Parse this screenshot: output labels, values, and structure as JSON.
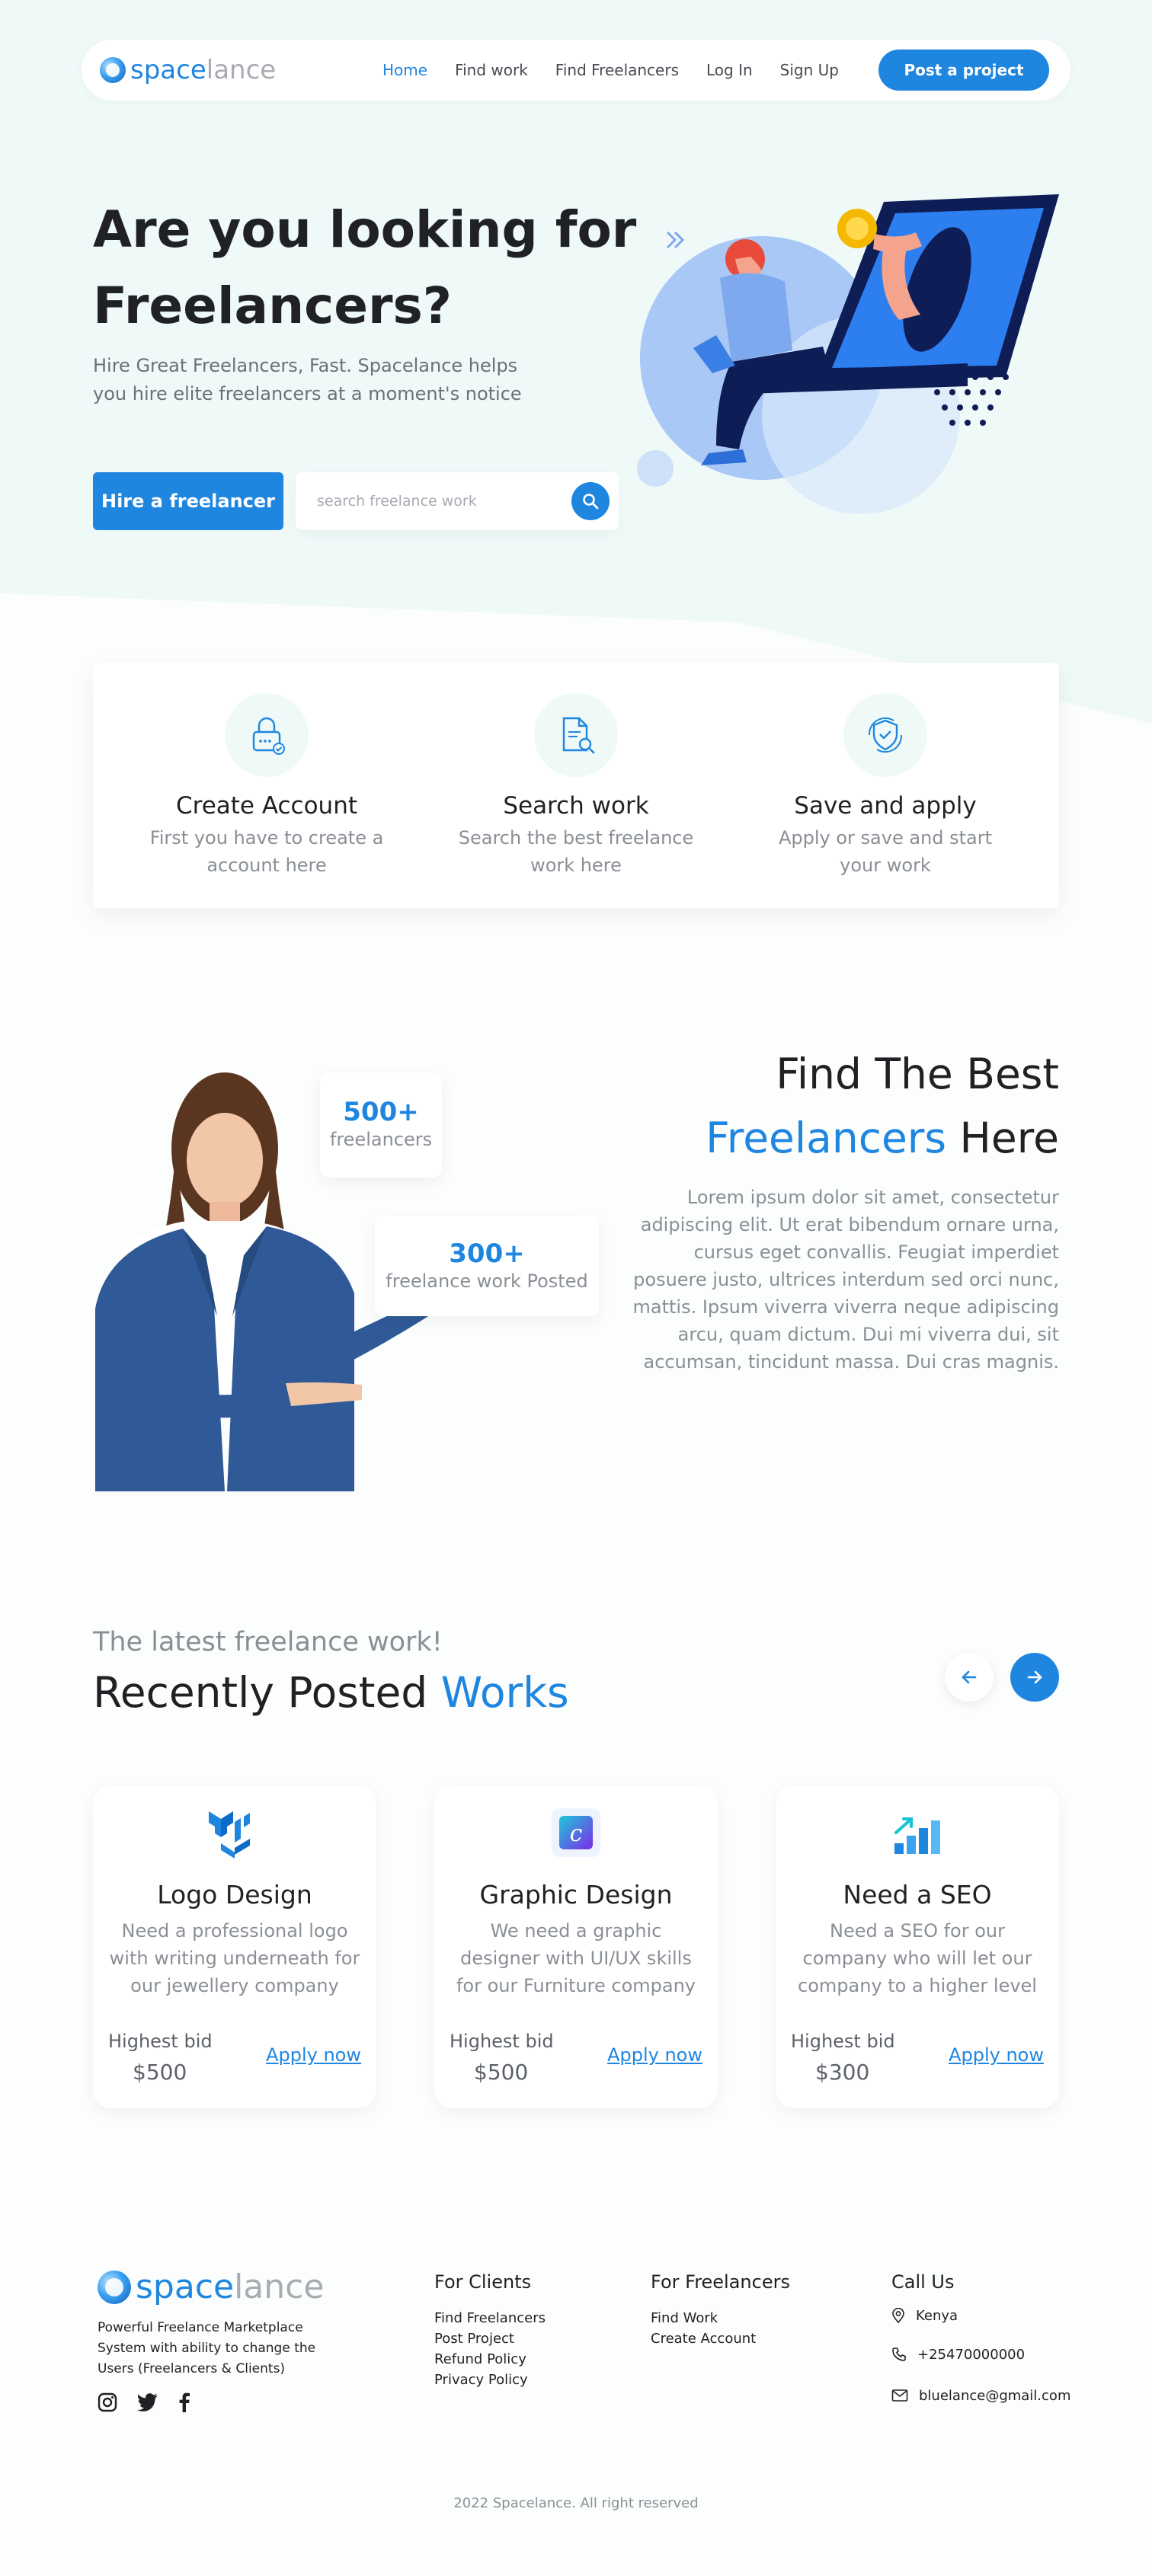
{
  "brand": {
    "part1": "space",
    "part2": "lance"
  },
  "nav": {
    "links": [
      "Home",
      "Find work",
      "Find Freelancers",
      "Log In",
      "Sign Up"
    ],
    "cta": "Post a project"
  },
  "hero": {
    "title_line1": "Are you looking for",
    "title_line2": "Freelancers?",
    "subtitle": "Hire Great Freelancers, Fast. Spacelance helps you hire elite freelancers at a moment's notice",
    "hire_button": "Hire a freelancer",
    "search_placeholder": "search freelance work"
  },
  "features": [
    {
      "icon": "lock-icon",
      "title": "Create Account",
      "text": "First you have to create a account  here"
    },
    {
      "icon": "document-search-icon",
      "title": "Search work",
      "text": "Search the best freelance work here"
    },
    {
      "icon": "shield-check-icon",
      "title": "Save and apply",
      "text": "Apply or save and start your work"
    }
  ],
  "stats": [
    {
      "value": "500+",
      "label": "freelancers"
    },
    {
      "value": "300+",
      "label": "freelance work Posted"
    }
  ],
  "about": {
    "title_line1": "Find The Best",
    "title_blue": "Freelancers",
    "title_rest": " Here",
    "text": "Lorem ipsum dolor sit amet, consectetur adipiscing elit. Ut erat bibendum ornare urna, cursus eget convallis. Feugiat imperdiet posuere justo, ultrices interdum sed orci nunc, mattis. Ipsum viverra viverra neque adipiscing arcu, quam dictum. Dui mi viverra dui, sit accumsan, tincidunt massa. Dui cras magnis."
  },
  "works": {
    "kicker": "The latest freelance work!",
    "title_main": "Recently Posted ",
    "title_blue": "Works",
    "cards": [
      {
        "icon": "mui-logo-icon",
        "title": "Logo Design",
        "text": "Need a professional logo with writing underneath for our jewellery company",
        "bid_label": "Highest bid",
        "bid": "$500",
        "action": "Apply now"
      },
      {
        "icon": "canva-icon",
        "title": "Graphic Design",
        "text": "We need a graphic designer with UI/UX skills for our Furniture company",
        "bid_label": "Highest bid",
        "bid": "$500",
        "action": "Apply now"
      },
      {
        "icon": "seo-chart-icon",
        "title": "Need a SEO",
        "text": "Need a SEO for our company who will let our company to a higher level",
        "bid_label": "Highest bid",
        "bid": "$300",
        "action": "Apply now"
      }
    ]
  },
  "footer": {
    "description": "Powerful Freelance Marketplace System with ability to change the Users (Freelancers & Clients)",
    "clients": {
      "heading": "For Clients",
      "items": [
        "Find Freelancers",
        "Post Project",
        "Refund Policy",
        "Privacy Policy"
      ]
    },
    "freelancers": {
      "heading": "For Freelancers",
      "items": [
        "Find Work",
        "Create Account"
      ]
    },
    "call": {
      "heading": "Call Us",
      "location": "Kenya",
      "phone": "+25470000000",
      "email": "bluelance@gmail.com"
    },
    "copyright": "2022 Spacelance. All right reserved"
  },
  "colors": {
    "accent": "#1f86e0",
    "hero_bg": "#eef9f8",
    "text": "#1f2124",
    "muted": "#8a8f96"
  }
}
